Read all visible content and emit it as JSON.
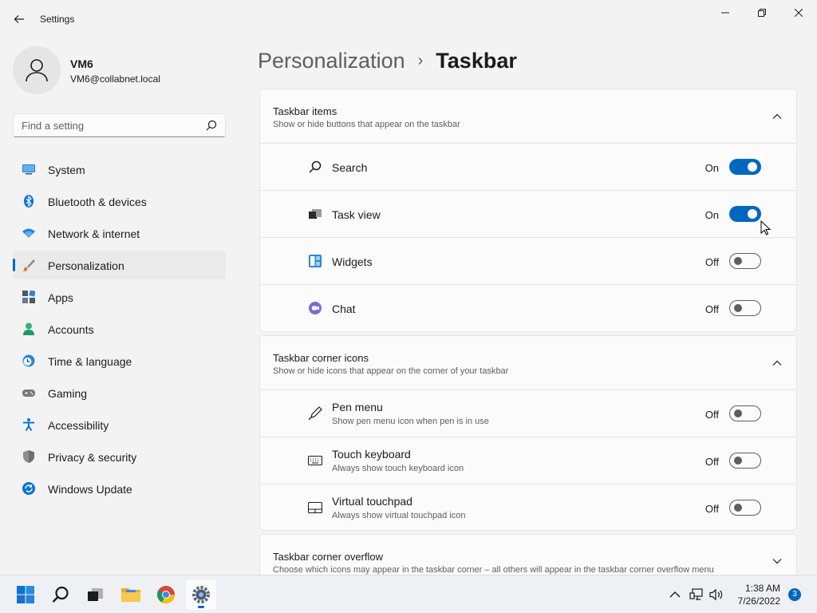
{
  "window": {
    "title": "Settings"
  },
  "user": {
    "name": "VM6",
    "email": "VM6@collabnet.local"
  },
  "search": {
    "placeholder": "Find a setting"
  },
  "sidebar": {
    "items": [
      {
        "label": "System",
        "icon": "monitor-icon"
      },
      {
        "label": "Bluetooth & devices",
        "icon": "bluetooth-icon"
      },
      {
        "label": "Network & internet",
        "icon": "wifi-icon"
      },
      {
        "label": "Personalization",
        "icon": "brush-icon",
        "active": true
      },
      {
        "label": "Apps",
        "icon": "apps-icon"
      },
      {
        "label": "Accounts",
        "icon": "person-icon"
      },
      {
        "label": "Time & language",
        "icon": "clock-globe-icon"
      },
      {
        "label": "Gaming",
        "icon": "gamepad-icon"
      },
      {
        "label": "Accessibility",
        "icon": "accessibility-icon"
      },
      {
        "label": "Privacy & security",
        "icon": "shield-icon"
      },
      {
        "label": "Windows Update",
        "icon": "update-icon"
      }
    ]
  },
  "breadcrumb": {
    "parent": "Personalization",
    "separator": "›",
    "current": "Taskbar"
  },
  "sections": {
    "items": {
      "title": "Taskbar items",
      "subtitle": "Show or hide buttons that appear on the taskbar",
      "rows": [
        {
          "label": "Search",
          "state": "On",
          "on": true,
          "icon": "search-icon"
        },
        {
          "label": "Task view",
          "state": "On",
          "on": true,
          "icon": "task-view-icon"
        },
        {
          "label": "Widgets",
          "state": "Off",
          "on": false,
          "icon": "widgets-icon"
        },
        {
          "label": "Chat",
          "state": "Off",
          "on": false,
          "icon": "chat-icon"
        }
      ]
    },
    "corner": {
      "title": "Taskbar corner icons",
      "subtitle": "Show or hide icons that appear on the corner of your taskbar",
      "rows": [
        {
          "label": "Pen menu",
          "sub": "Show pen menu icon when pen is in use",
          "state": "Off",
          "on": false,
          "icon": "pen-icon"
        },
        {
          "label": "Touch keyboard",
          "sub": "Always show touch keyboard icon",
          "state": "Off",
          "on": false,
          "icon": "keyboard-icon"
        },
        {
          "label": "Virtual touchpad",
          "sub": "Always show virtual touchpad icon",
          "state": "Off",
          "on": false,
          "icon": "touchpad-icon"
        }
      ]
    },
    "overflow": {
      "title": "Taskbar corner overflow",
      "subtitle": "Choose which icons may appear in the taskbar corner – all others will appear in the taskbar corner overflow menu"
    }
  },
  "taskbar": {
    "time": "1:38 AM",
    "date": "7/26/2022",
    "notifications": "3"
  },
  "colors": {
    "accent": "#0067c0",
    "background": "#f3f3f3",
    "card": "#fbfbfb"
  }
}
